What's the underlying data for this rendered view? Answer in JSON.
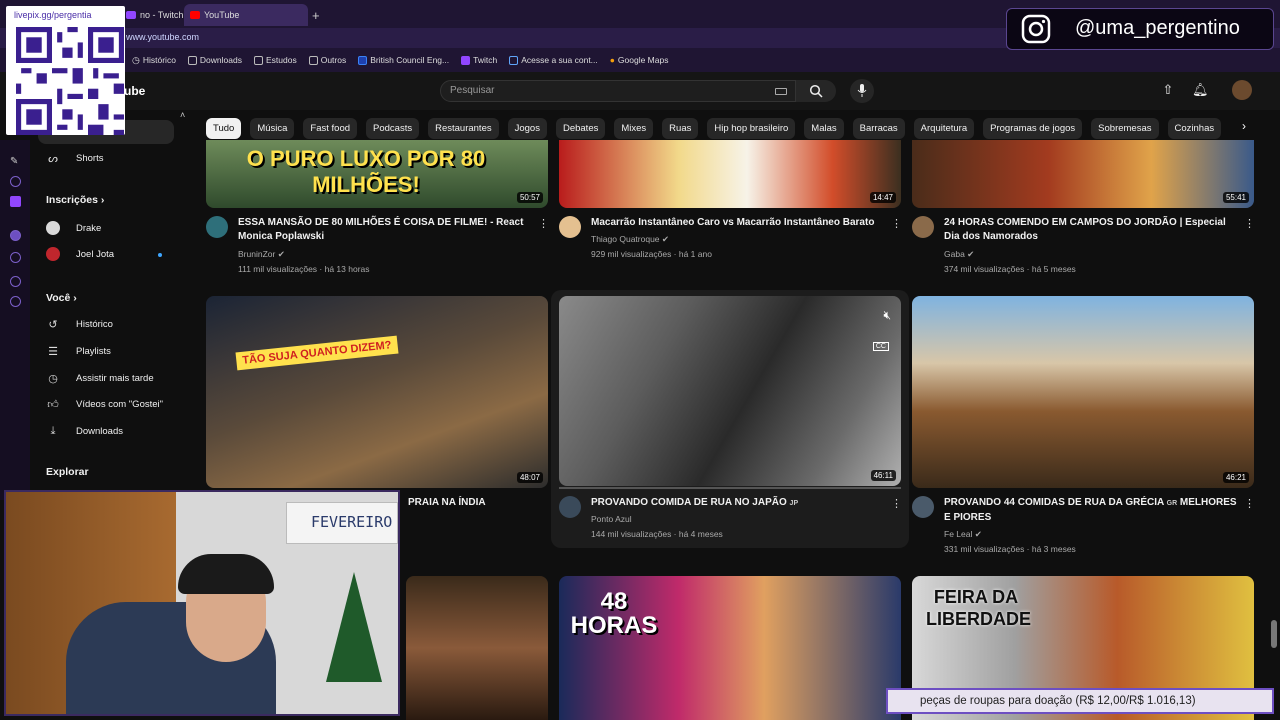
{
  "browser": {
    "tabs": [
      {
        "label": "no - Twitch",
        "color": "#9146ff"
      },
      {
        "label": "YouTube",
        "color": "#ff0000"
      }
    ],
    "url": "www.youtube.com",
    "bookmarks": [
      "Histórico",
      "Downloads",
      "Estudos",
      "Outros",
      "British Council Eng...",
      "Twitch",
      "Acesse a sua cont...",
      "Google Maps"
    ]
  },
  "header": {
    "logo": "ube",
    "search_placeholder": "Pesquisar"
  },
  "chips": [
    "Tudo",
    "Música",
    "Fast food",
    "Podcasts",
    "Restaurantes",
    "Jogos",
    "Debates",
    "Mixes",
    "Ruas",
    "Hip hop brasileiro",
    "Malas",
    "Barracas",
    "Arquitetura",
    "Programas de jogos",
    "Sobremesas",
    "Cozinhas"
  ],
  "sidebar": {
    "shorts": "Shorts",
    "subscriptions_head": "Inscrições",
    "subs": [
      {
        "name": "Drake",
        "color": "#d9d9d9"
      },
      {
        "name": "Joel Jota",
        "color": "#c0262d"
      }
    ],
    "you_head": "Você",
    "you_items": [
      {
        "label": "Histórico",
        "icon": "history-icon"
      },
      {
        "label": "Playlists",
        "icon": "playlist-icon"
      },
      {
        "label": "Assistir mais tarde",
        "icon": "clock-icon"
      },
      {
        "label": "Vídeos com \"Gostei\"",
        "icon": "like-icon"
      },
      {
        "label": "Downloads",
        "icon": "download-icon"
      }
    ],
    "explore_head": "Explorar"
  },
  "videos_row1": [
    {
      "title": "ESSA MANSÃO DE 80 MILHÕES É COISA DE FILME! - React Monica Poplawski",
      "channel": "BruninZor",
      "meta": "111 mil visualizações · há 13 horas",
      "duration": "50:57",
      "overlay": "O PURO LUXO POR 80 MILHÕES!",
      "verified": true
    },
    {
      "title": "Macarrão Instantâneo Caro vs Macarrão Instantâneo Barato",
      "channel": "Thiago Quatroque",
      "meta": "929 mil visualizações · há 1 ano",
      "duration": "14:47",
      "verified": true
    },
    {
      "title": "24 HORAS COMENDO EM CAMPOS DO JORDÃO | Especial Dia dos Namorados",
      "channel": "Gaba",
      "meta": "374 mil visualizações · há 5 meses",
      "duration": "55:41",
      "verified": true
    }
  ],
  "videos_row2": [
    {
      "title": "PRAIA NA ÍNDIA",
      "duration": "48:07",
      "overlay": "TÃO SUJA QUANTO DIZEM?"
    },
    {
      "title": "PROVANDO COMIDA DE RUA NO JAPÃO",
      "tag": "JP",
      "channel": "Ponto Azul",
      "meta": "144 mil visualizações · há 4 meses",
      "duration": "46:11"
    },
    {
      "title": "PROVANDO 44 COMIDAS DE RUA DA GRÉCIA",
      "tag": "GR",
      "title_cont": "MELHORES E PIORES",
      "channel": "Fe Leal",
      "meta": "331 mil visualizações · há 3 meses",
      "duration": "46:21",
      "verified": true
    }
  ],
  "videos_row3": [
    {
      "overlay": "48 HORAS"
    },
    {
      "overlay": "FEIRA DA LIBERDADE"
    }
  ],
  "overlays": {
    "qr_label": "livepix.gg/pergentia",
    "instagram": "@uma_pergentino",
    "webcam_sign": "FEVEREIRO",
    "donation": "peças de roupas para doação (R$ 12,00/R$ 1.016,13)"
  }
}
